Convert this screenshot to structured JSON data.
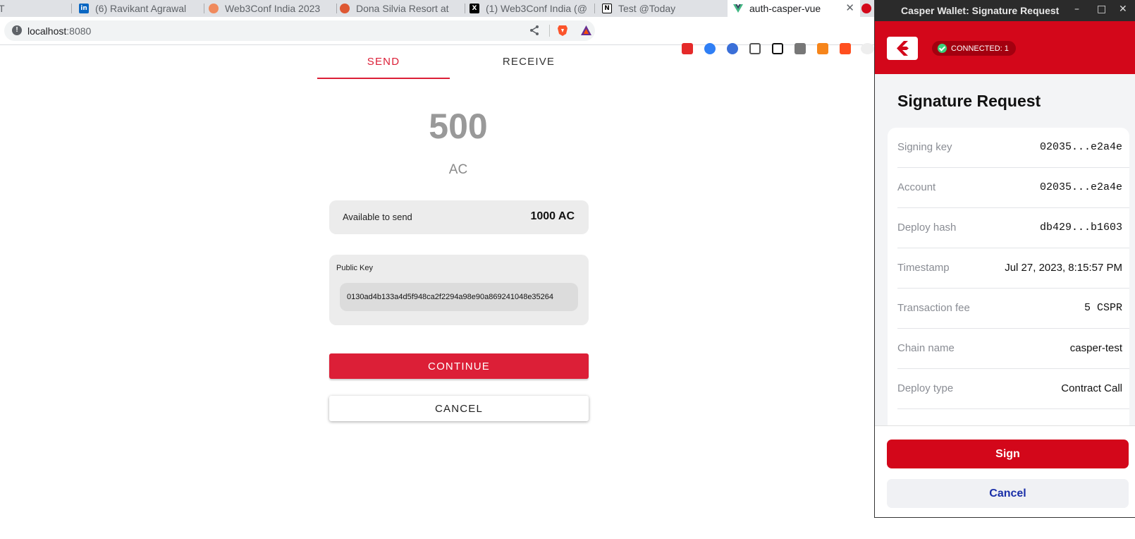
{
  "browser": {
    "tabs": [
      {
        "title": "T",
        "favicon": "openai-icon"
      },
      {
        "title": "(6) Ravikant Agrawal",
        "favicon": "linkedin-icon"
      },
      {
        "title": "Web3Conf India 2023",
        "favicon": "web3conf-icon"
      },
      {
        "title": "Dona Silvia Resort at",
        "favicon": "duckduckgo-icon"
      },
      {
        "title": "(1) Web3Conf India (@",
        "favicon": "x-icon"
      },
      {
        "title": "Test @Today",
        "favicon": "notion-icon"
      },
      {
        "title": "auth-casper-vue",
        "favicon": "vue-icon"
      }
    ],
    "url_host": "localhost",
    "url_port": ":8080"
  },
  "page": {
    "tab_send": "SEND",
    "tab_receive": "RECEIVE",
    "amount": "500",
    "unit": "AC",
    "available_label": "Available to send",
    "available_value": "1000 AC",
    "public_key_label": "Public Key",
    "public_key_value": "0130ad4b133a4d5f948ca2f2294a98e90a869241048e35264",
    "continue_label": "CONTINUE",
    "cancel_label": "CANCEL"
  },
  "wallet": {
    "window_title": "Casper Wallet: Signature Request",
    "connected": "CONNECTED: 1",
    "heading": "Signature Request",
    "rows": [
      {
        "key": "Signing key",
        "value": "02035...e2a4e",
        "mono": true
      },
      {
        "key": "Account",
        "value": "02035...e2a4e",
        "mono": true
      },
      {
        "key": "Deploy hash",
        "value": "db429...b1603",
        "mono": true
      },
      {
        "key": "Timestamp",
        "value": "Jul 27, 2023, 8:15:57 PM",
        "mono": false
      },
      {
        "key": "Transaction fee",
        "value": "5 CSPR",
        "mono": true
      },
      {
        "key": "Chain name",
        "value": "casper-test",
        "mono": false
      },
      {
        "key": "Deploy type",
        "value": "Contract Call",
        "mono": false
      }
    ],
    "sign_label": "Sign",
    "cancel_label": "Cancel"
  },
  "colors": {
    "accent": "#dc1f37",
    "wallet_red": "#d3071a",
    "wallet_link": "#1a2fa8"
  }
}
